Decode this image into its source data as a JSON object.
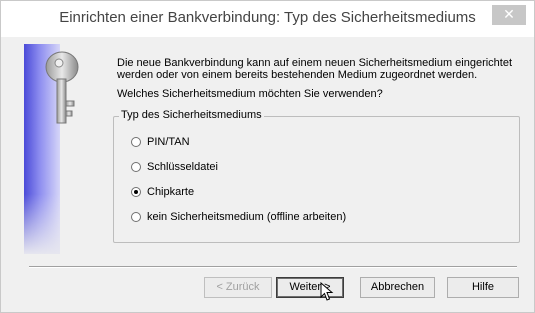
{
  "window": {
    "title": "Einrichten einer Bankverbindung: Typ des Sicherheitsmediums",
    "close_glyph": "✕"
  },
  "content": {
    "intro": "Die neue Bankverbindung kann  auf einem neuen Sicherheitsmedium eingerichtet werden oder von einem bereits bestehenden Medium zugeordnet werden.",
    "question": "Welches Sicherheitsmedium möchten Sie verwenden?"
  },
  "medium_group": {
    "legend": "Typ des Sicherheitsmediums",
    "options": [
      {
        "label": "PIN/TAN",
        "checked": false
      },
      {
        "label": "Schlüsseldatei",
        "checked": false
      },
      {
        "label": "Chipkarte",
        "checked": true
      },
      {
        "label": "kein Sicherheitsmedium (offline arbeiten)",
        "checked": false
      }
    ]
  },
  "buttons": {
    "back": "< Zurück",
    "next": "Weiter >",
    "cancel": "Abbrechen",
    "help": "Hilfe"
  },
  "icons": {
    "sidebar": "key-icon",
    "cursor": "mouse-pointer-icon"
  }
}
